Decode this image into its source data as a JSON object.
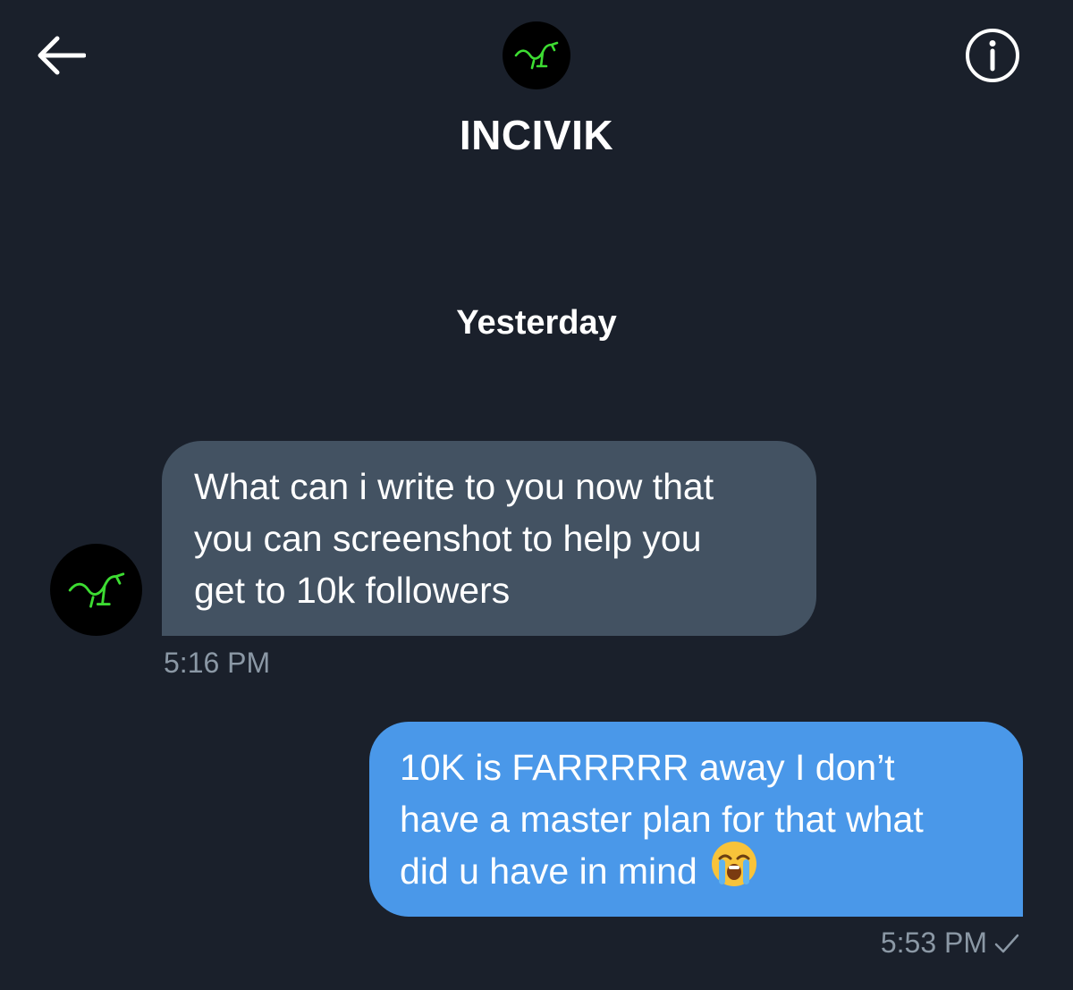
{
  "header": {
    "contact_name": "INCIVIK",
    "back_icon": "arrow-left-icon",
    "info_icon": "info-circle-icon",
    "avatar_icon": "green-dog-logo-icon"
  },
  "conversation": {
    "date_divider": "Yesterday",
    "messages": [
      {
        "direction": "incoming",
        "lines": [
          "What can i write to you now that",
          "you can screenshot to help you",
          "get to 10k followers"
        ],
        "time": "5:16 PM"
      },
      {
        "direction": "outgoing",
        "lines": [
          "10K is FARRRRR away I don’t",
          "have a master plan for that what",
          "did u have in mind"
        ],
        "emoji": "loudly-crying-face-icon",
        "time": "5:53 PM",
        "status_icon": "checkmark-icon"
      }
    ]
  },
  "colors": {
    "background": "#1a202b",
    "incoming_bubble": "#435262",
    "outgoing_bubble": "#4a98e9",
    "timestamp": "#8b98a5",
    "logo_green": "#3ddc32"
  }
}
